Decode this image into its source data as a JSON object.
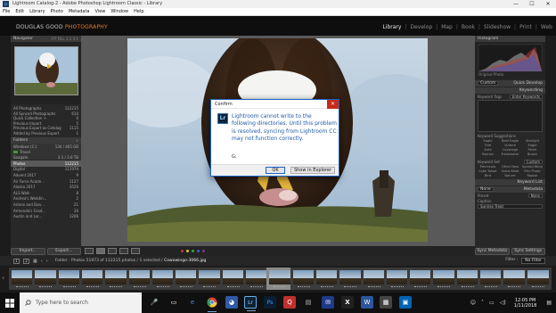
{
  "window": {
    "title": "Lightroom Catalog-2 - Adobe Photoshop Lightroom Classic - Library",
    "app_icon": "Lr",
    "controls": [
      "—",
      "☐",
      "✕"
    ]
  },
  "menu": [
    "File",
    "Edit",
    "Library",
    "Photo",
    "Metadata",
    "View",
    "Window",
    "Help"
  ],
  "identity": {
    "name": "DOUGLAS GOOD",
    "suffix": "PHOTOGRAPHY",
    "modules": [
      "Library",
      "Develop",
      "Map",
      "Book",
      "Slideshow",
      "Print",
      "Web"
    ],
    "active_module": "Library"
  },
  "left_panel": {
    "navigator": {
      "label": "Navigator",
      "zoom": "FIT  FILL  1:1  3:1"
    },
    "catalog": [
      {
        "name": "All Photographs",
        "count": "112215"
      },
      {
        "name": "All Synced Photographs",
        "count": "610"
      },
      {
        "name": "Quick Collection +",
        "count": "0"
      },
      {
        "name": "Previous Import",
        "count": "5"
      },
      {
        "name": "Previous Export as Catalog",
        "count": "1115"
      },
      {
        "name": "Added by Previous Export",
        "count": "1"
      }
    ],
    "folders_label": "Folders",
    "volumes": [
      {
        "name": "Windows (C:)",
        "info": "134 / 465 GB"
      },
      {
        "name": "Travel",
        "info": ""
      },
      {
        "name": "Seagate",
        "info": "3.1 / 3.6 TB"
      }
    ],
    "folders": [
      {
        "name": "Photos",
        "count": "112215"
      },
      {
        "name": "Digital",
        "count": "111979"
      },
      {
        "name": "Advent 2017",
        "count": "9"
      },
      {
        "name": "Air Force Acade...",
        "count": "1127"
      },
      {
        "name": "Alaska 2017",
        "count": "3526"
      },
      {
        "name": "ALS Walk",
        "count": "8"
      },
      {
        "name": "Andrea's Weddin...",
        "count": "2"
      },
      {
        "name": "Arlene and Dan...",
        "count": "21"
      },
      {
        "name": "Armenda's Grad...",
        "count": "26"
      },
      {
        "name": "Austin and Lor...",
        "count": "1206"
      }
    ],
    "import_label": "Import...",
    "export_label": "Export..."
  },
  "right_panel": {
    "histogram_label": "Histogram",
    "original_photo": "Original Photo",
    "quick_develop": {
      "label": "Quick Develop",
      "preset": "Custom"
    },
    "keywording": {
      "label": "Keywording",
      "tags_label": "Keyword Tags",
      "placeholder": "Enter Keywords"
    },
    "keyword_suggestions_label": "Keyword Suggestions",
    "suggestions": [
      "Eagle",
      "Bald Eagle",
      "Starlight",
      "Tree",
      "Vulture",
      "Eagle",
      "Auto",
      "Coverage",
      "Perch",
      "Barnes",
      "Freshwater",
      "Brown"
    ],
    "keyword_set": {
      "label": "Keyword Set",
      "value": "Custom"
    },
    "set_words": [
      "Peninsula",
      "Other New",
      "Spread Wings",
      "Lake Tahoe",
      "Snow Birds",
      "Pier Photo",
      "Bird",
      "Nature",
      "Raptor"
    ],
    "keyword_list_label": "Keyword List",
    "metadata": {
      "label": "Metadata",
      "preset_label": "Preset",
      "preset_value": "None",
      "title_label": "Caption",
      "title_value": "Sunrise Treat"
    },
    "sync_label": "Sync Metadata",
    "sync_settings_label": "Sync Settings"
  },
  "filmstrip": {
    "numbers": [
      "1",
      "2"
    ],
    "source": "Folder : Photos",
    "info": "51973 of 112215 photos / 1 selected /",
    "filename": "Cowowingo-3066.jpg",
    "filter_label": "Filter :",
    "filter_value": "No Filter",
    "thumb_count": 23,
    "selected_index": 11
  },
  "dialog": {
    "title": "Confirm",
    "icon": "Lr",
    "message": "Lightroom cannot write to the following directories. Until this problem is resolved, syncing from Lightroom CC may not function correctly.",
    "path": "G:",
    "ok_label": "OK",
    "explorer_label": "Show in Explorer",
    "close": "✕"
  },
  "taskbar": {
    "search_placeholder": "Type here to search",
    "time": "12:05 PM",
    "date": "1/11/2018",
    "apps": [
      "task-view",
      "edge",
      "chrome",
      "firefox",
      "lightroom",
      "photoshop",
      "outlook",
      "quicken",
      "mail",
      "explorer",
      "skype",
      "excel",
      "crossover",
      "word",
      "calculator",
      "pictures"
    ]
  }
}
